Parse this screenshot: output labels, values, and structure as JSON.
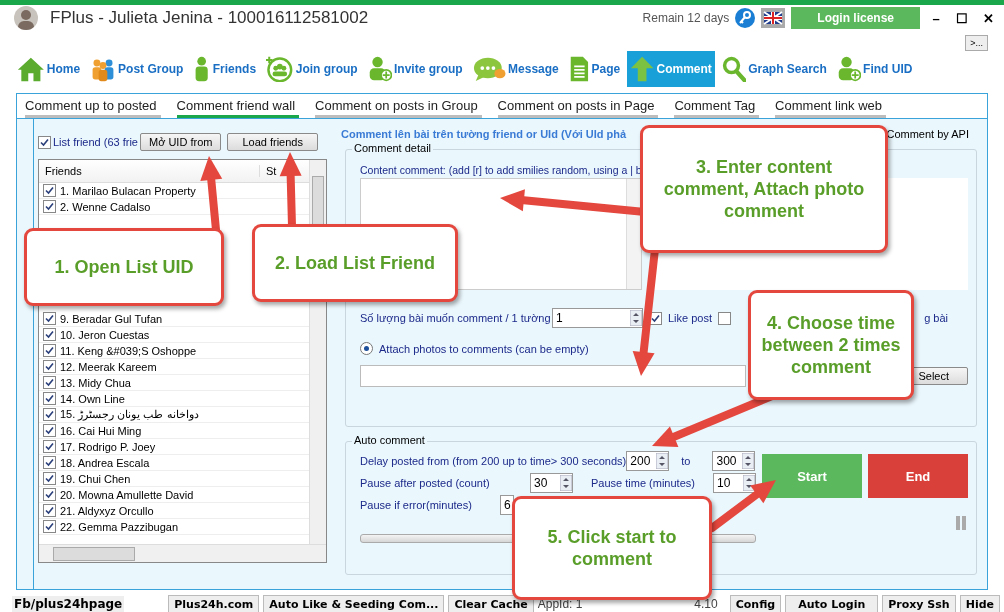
{
  "window": {
    "title": "FPlus - Julieta Jenina - 100016112581002",
    "remain": "Remain 12 days",
    "login_button": "Login license",
    "controls": [
      "–",
      "☐",
      "✕"
    ],
    "more_button": ">..."
  },
  "nav": [
    {
      "label": "Home",
      "selected": false
    },
    {
      "label": "Post Group",
      "selected": false
    },
    {
      "label": "Friends",
      "selected": false
    },
    {
      "label": "Join group",
      "selected": false
    },
    {
      "label": "Invite group",
      "selected": false
    },
    {
      "label": "Message",
      "selected": false
    },
    {
      "label": "Page",
      "selected": false
    },
    {
      "label": "Comment",
      "selected": true
    },
    {
      "label": "Graph Search",
      "selected": false
    },
    {
      "label": "Find UID",
      "selected": false
    }
  ],
  "subtabs": [
    {
      "label": "Comment up to posted",
      "selected": false
    },
    {
      "label": "Comment friend wall",
      "selected": true
    },
    {
      "label": "Comment on posts in Group",
      "selected": false
    },
    {
      "label": "Comment on posts in Page",
      "selected": false
    },
    {
      "label": "Comment Tag",
      "selected": false
    },
    {
      "label": "Comment link web",
      "selected": false
    }
  ],
  "left": {
    "list_friend": {
      "label": "List friend (63 frie",
      "checked": true
    },
    "open_button": "Mở UID from",
    "load_button": "Load friends",
    "columns": [
      "Friends",
      "St"
    ],
    "friends_top": [
      {
        "name": "1. Marilao Bulacan Property",
        "checked": true
      },
      {
        "name": "2. Wenne Cadalso",
        "checked": true
      }
    ],
    "friends": [
      {
        "name": "9. Beradar Gul Tufan",
        "checked": true
      },
      {
        "name": "10. Jeron Cuestas",
        "checked": true
      },
      {
        "name": "11. Keng &#039;S Oshoppe",
        "checked": true
      },
      {
        "name": "12. Meerak Kareem",
        "checked": true
      },
      {
        "name": "13. Midy Chua",
        "checked": true
      },
      {
        "name": "14. Own Line",
        "checked": true
      },
      {
        "name": "15. دواخانه طب یونان رجسٹرڑ",
        "checked": true
      },
      {
        "name": "16. Cai Hui Ming",
        "checked": true
      },
      {
        "name": "17. Rodrigo P. Joey",
        "checked": true
      },
      {
        "name": "18. Andrea Escala",
        "checked": true
      },
      {
        "name": "19. Chui Chen",
        "checked": true
      },
      {
        "name": "20. Mowna Amullette David",
        "checked": true
      },
      {
        "name": "21. Aldyxyz Orcullo",
        "checked": true
      },
      {
        "name": "22. Gemma Pazzibugan",
        "checked": true
      }
    ]
  },
  "right": {
    "heading": "Comment lên bài trên tường friend or UId (Với UId phả",
    "api_label": "Comment by API",
    "detail": {
      "legend": "Comment detail",
      "content_label": "Content comment: (add [r] to add smilies random, using a | b",
      "count_label": "Số lượng bài muốn comment / 1 tường",
      "count_value": "1",
      "like_post": {
        "label": "Like post",
        "checked": true
      },
      "second_option": {
        "checked": false
      },
      "second_tail": "g bài",
      "attach": {
        "label": "Attach photos to comments (can be empty)",
        "selected": true
      },
      "select_button": "Select"
    },
    "auto": {
      "legend": "Auto comment",
      "delay_label": "Delay posted from (from 200 up to time> 300 seconds)",
      "delay_from": "200",
      "to_label": "to",
      "delay_to": "300",
      "pause_after_label": "Pause after posted (count)",
      "pause_after": "30",
      "pause_time_label": "Pause time (minutes)",
      "pause_time": "10",
      "pause_error_label": "Pause if error(minutes)",
      "pause_error": "6",
      "start": "Start",
      "end": "End",
      "progress": {
        "level": 0
      }
    }
  },
  "status_bar": {
    "link": "Fb/plus24hpage",
    "buttons_left": [
      "Plus24h.com",
      "Auto Like & Seeding Com...",
      "Clear Cache"
    ],
    "appid": "AppId: 1",
    "version": "4.10",
    "buttons_right": [
      "Config",
      "Auto Login",
      "Proxy Ssh",
      "Hide"
    ]
  },
  "callouts": [
    "1. Open List UID",
    "2. Load List Friend",
    "3. Enter content comment, Attach photo comment",
    "4. Choose time between 2 times comment",
    "5. Click start to comment"
  ]
}
